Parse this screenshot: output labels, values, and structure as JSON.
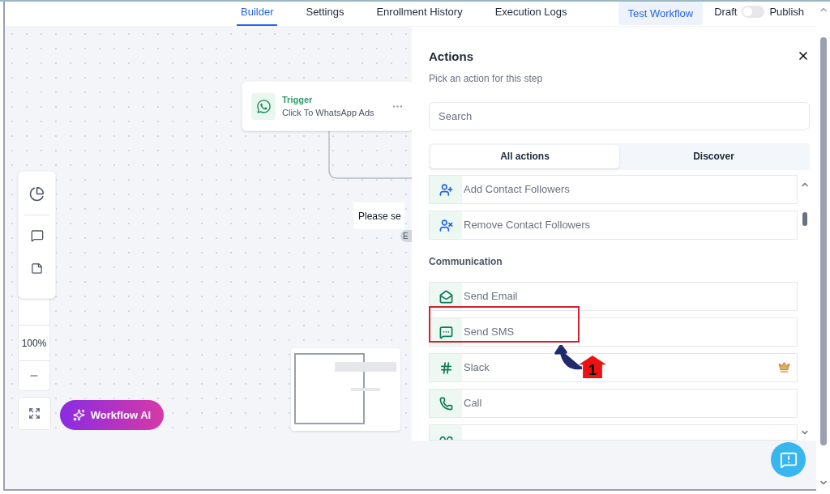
{
  "tabs": [
    {
      "label": "Builder",
      "selected": true
    },
    {
      "label": "Settings",
      "selected": false
    },
    {
      "label": "Enrollment History",
      "selected": false
    },
    {
      "label": "Execution Logs",
      "selected": false
    }
  ],
  "test_button": "Test Workflow",
  "publish_toggle": {
    "off_label": "Draft",
    "on_label": "Publish",
    "on": false
  },
  "canvas": {
    "trigger": {
      "title": "Trigger",
      "subtitle": "Click To WhatsApp Ads"
    },
    "hint": "Please se",
    "badge": "E",
    "zoom": "100%",
    "ai_button": "Workflow AI"
  },
  "panel": {
    "title": "Actions",
    "subtitle": "Pick an action for this step",
    "search": {
      "placeholder": "Search"
    },
    "tabs": [
      {
        "label": "All actions",
        "selected": true
      },
      {
        "label": "Discover",
        "selected": false
      }
    ],
    "groups": [
      {
        "items": [
          {
            "label": "Add Contact Followers",
            "color": "#2563eb",
            "premium": false
          },
          {
            "label": "Remove Contact Followers",
            "color": "#2563eb",
            "premium": false
          }
        ]
      },
      {
        "heading": "Communication",
        "items": [
          {
            "label": "Send Email",
            "color": "#0f7a5a",
            "premium": false
          },
          {
            "label": "Send SMS",
            "color": "#0f7a5a",
            "premium": false
          },
          {
            "label": "Slack",
            "color": "#0f7a5a",
            "premium": true
          },
          {
            "label": "Call",
            "color": "#0f7a5a",
            "premium": false
          },
          {
            "color": "#0f7a5a"
          }
        ]
      }
    ]
  },
  "annotation": {
    "number": "1"
  }
}
